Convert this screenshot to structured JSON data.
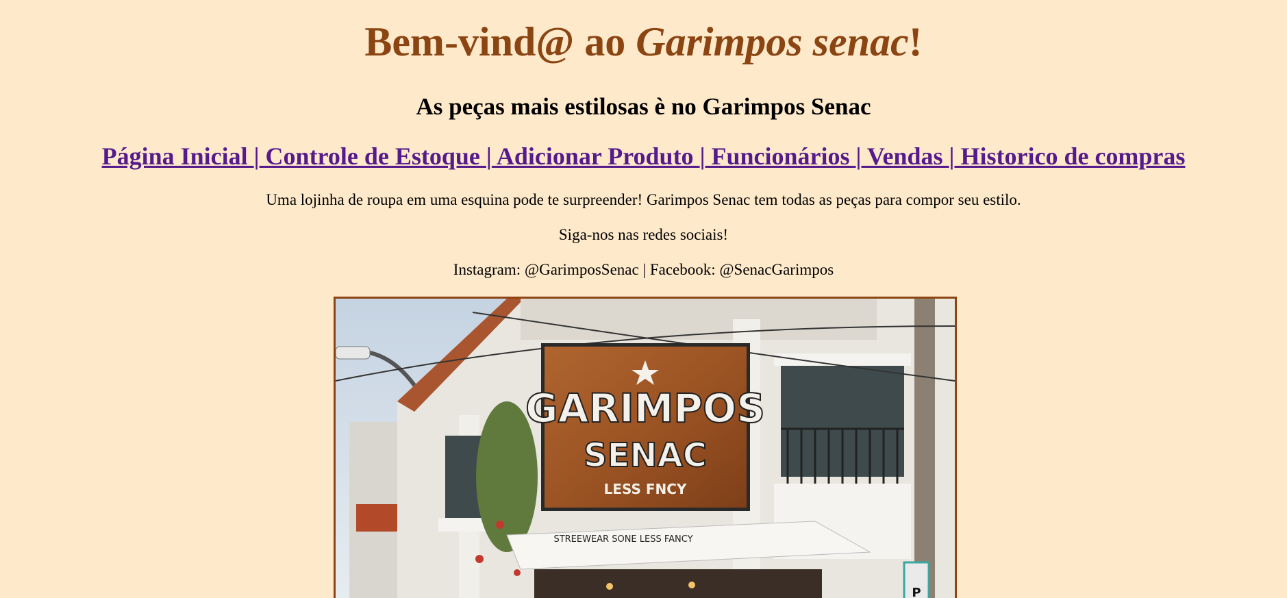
{
  "header": {
    "title_prefix": "Bem-vind@ ao ",
    "title_brand": "Garimpos senac",
    "title_suffix": "!",
    "subtitle": "As peças mais estilosas è no Garimpos Senac"
  },
  "nav": {
    "items": [
      {
        "label": "Página Inicial "
      },
      {
        "label": " Controle de Estoque "
      },
      {
        "label": " Adicionar Produto "
      },
      {
        "label": " Funcionários "
      },
      {
        "label": " Vendas "
      },
      {
        "label": " Historico de compras"
      }
    ],
    "separator": "|"
  },
  "intro": {
    "text": "Uma lojinha de roupa em uma esquina pode te surpreender! Garimpos Senac tem todas as peças para compor seu estilo.",
    "social_heading": "Siga-nos nas redes sociais!",
    "social_links": "Instagram: @GarimposSenac | Facebook: @SenacGarimpos"
  },
  "storefront_image": {
    "sign_line1": "GARIMPOS",
    "sign_line2": "SENAC",
    "sign_line3": "LESS FNCY",
    "awning_text": "STREEWEAR SONE LESS FANCY"
  },
  "colors": {
    "background": "#feeacb",
    "title": "#8b4513",
    "link": "#551a8b",
    "image_border": "#8b4513"
  }
}
